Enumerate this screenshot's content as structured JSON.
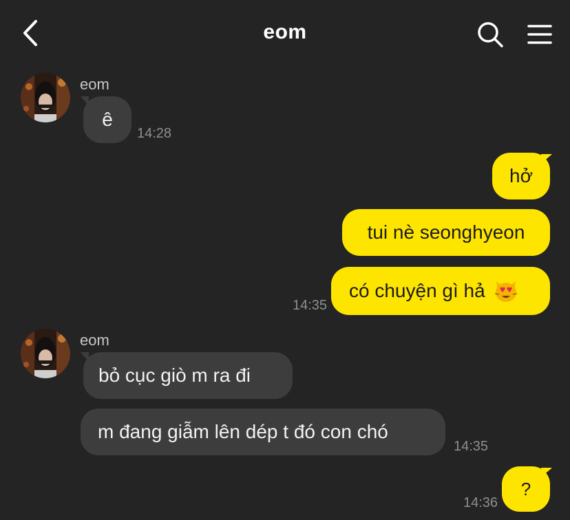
{
  "header": {
    "title": "eom",
    "icons": {
      "back": "chevron-left-icon",
      "search": "search-icon",
      "menu": "hamburger-menu-icon"
    }
  },
  "colors": {
    "background": "#242424",
    "incoming_bubble": "#3d3d3d",
    "outgoing_bubble": "#fee500",
    "timestamp": "#8f8f8f"
  },
  "messages": [
    {
      "direction": "in",
      "sender": "eom",
      "text": "ê",
      "time": "14:28"
    },
    {
      "direction": "out",
      "text": "hở"
    },
    {
      "direction": "out",
      "text": "tui nè seonghyeon"
    },
    {
      "direction": "out",
      "text": "có chuyện gì hả",
      "emoji": "heart-eyes-cat-emoji",
      "time": "14:35"
    },
    {
      "direction": "in",
      "sender": "eom",
      "text": "bỏ cục giò m ra đi"
    },
    {
      "direction": "in",
      "text": "m đang giẫm lên dép t đó con chó",
      "time": "14:35"
    },
    {
      "direction": "out",
      "text": "?",
      "time": "14:36"
    }
  ]
}
